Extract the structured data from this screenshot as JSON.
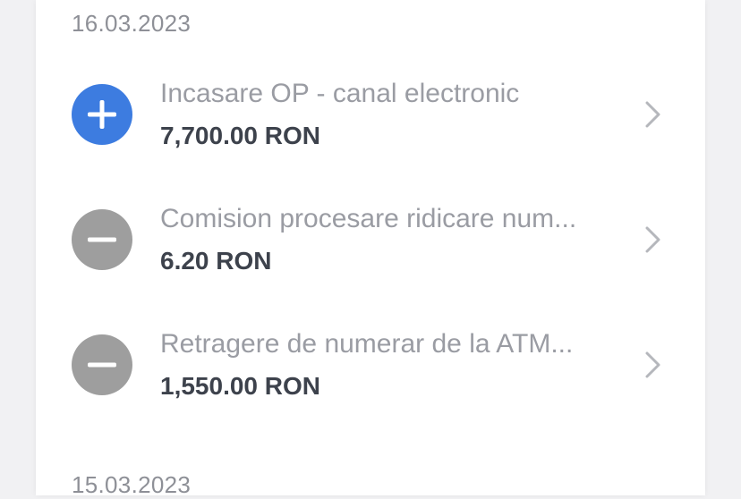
{
  "groups": [
    {
      "date": "16.03.2023",
      "transactions": [
        {
          "type": "credit",
          "icon": "plus-circle-icon",
          "description": "Incasare OP - canal electronic",
          "amount": "7,700.00 RON"
        },
        {
          "type": "debit",
          "icon": "minus-circle-icon",
          "description": "Comision procesare ridicare num...",
          "amount": "6.20 RON"
        },
        {
          "type": "debit",
          "icon": "minus-circle-icon",
          "description": "Retragere de numerar de la ATM...",
          "amount": "1,550.00 RON"
        }
      ]
    },
    {
      "date": "15.03.2023",
      "transactions": []
    }
  ],
  "colors": {
    "credit_icon": "#3d7ce0",
    "debit_icon": "#9e9e9e",
    "date_text": "#8e9097",
    "description_text": "#9a9ca3",
    "amount_text": "#3d424c",
    "chevron": "#b5b7bc",
    "background": "#f1f1f3",
    "card": "#ffffff"
  }
}
